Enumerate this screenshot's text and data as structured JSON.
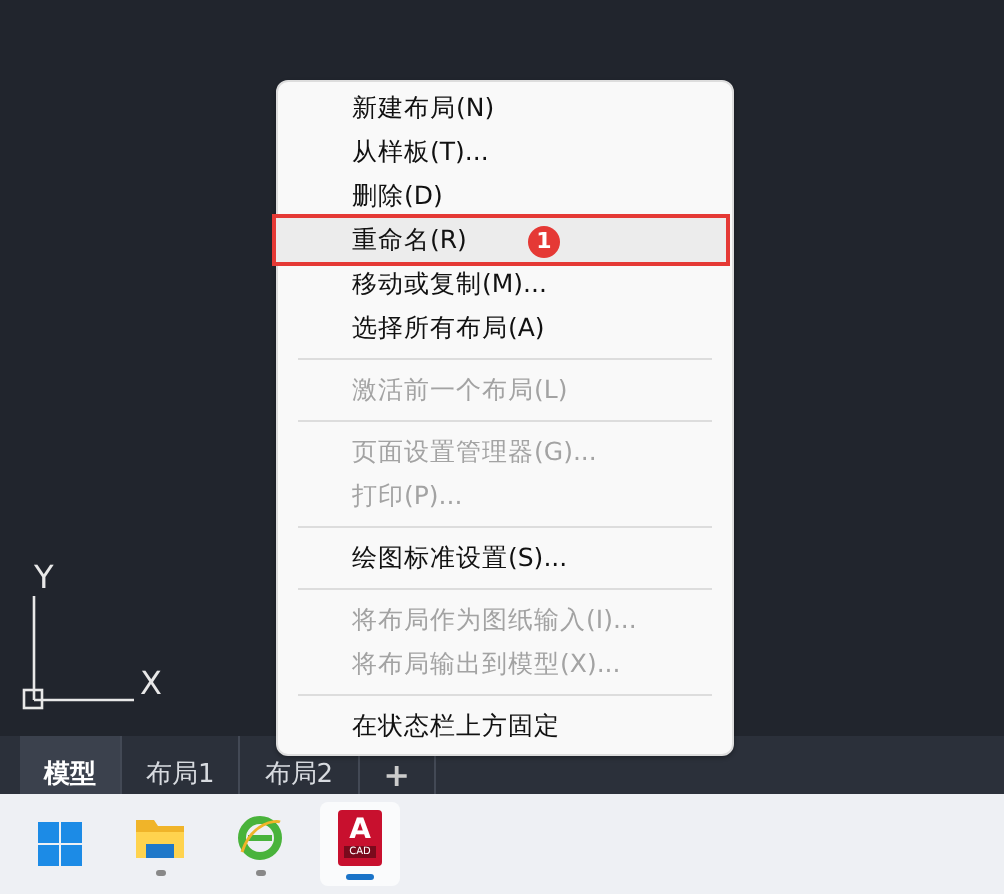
{
  "canvas": {
    "axis_labels": [
      "Y",
      "X"
    ]
  },
  "layout_tabs": [
    {
      "label": "模型",
      "selected": true,
      "kind": "layout"
    },
    {
      "label": "布局1",
      "selected": false,
      "kind": "layout"
    },
    {
      "label": "布局2",
      "selected": false,
      "kind": "layout"
    },
    {
      "label": "+",
      "selected": false,
      "kind": "add"
    }
  ],
  "context_menu": {
    "items": [
      {
        "kind": "item",
        "label": "新建布局(N)",
        "disabled": false,
        "highlighted": false
      },
      {
        "kind": "item",
        "label": "从样板(T)...",
        "disabled": false,
        "highlighted": false
      },
      {
        "kind": "item",
        "label": "删除(D)",
        "disabled": false,
        "highlighted": false
      },
      {
        "kind": "item",
        "label": "重命名(R)",
        "disabled": false,
        "highlighted": true,
        "badge": "1"
      },
      {
        "kind": "item",
        "label": "移动或复制(M)...",
        "disabled": false,
        "highlighted": false
      },
      {
        "kind": "item",
        "label": "选择所有布局(A)",
        "disabled": false,
        "highlighted": false
      },
      {
        "kind": "separator"
      },
      {
        "kind": "item",
        "label": "激活前一个布局(L)",
        "disabled": true,
        "highlighted": false
      },
      {
        "kind": "separator"
      },
      {
        "kind": "item",
        "label": "页面设置管理器(G)...",
        "disabled": true,
        "highlighted": false
      },
      {
        "kind": "item",
        "label": "打印(P)...",
        "disabled": true,
        "highlighted": false
      },
      {
        "kind": "separator"
      },
      {
        "kind": "item",
        "label": "绘图标准设置(S)...",
        "disabled": false,
        "highlighted": false
      },
      {
        "kind": "separator"
      },
      {
        "kind": "item",
        "label": "将布局作为图纸输入(I)...",
        "disabled": true,
        "highlighted": false
      },
      {
        "kind": "item",
        "label": "将布局输出到模型(X)...",
        "disabled": true,
        "highlighted": false
      },
      {
        "kind": "separator"
      },
      {
        "kind": "item",
        "label": "在状态栏上方固定",
        "disabled": false,
        "highlighted": false
      }
    ]
  },
  "taskbar": {
    "apps": [
      {
        "kind": "start",
        "running": false,
        "selected": false
      },
      {
        "kind": "folder",
        "running": true,
        "selected": false
      },
      {
        "kind": "browser",
        "running": true,
        "selected": false
      },
      {
        "kind": "cad",
        "running": true,
        "selected": true,
        "icon_letter": "A",
        "icon_caption": "CAD"
      }
    ]
  }
}
